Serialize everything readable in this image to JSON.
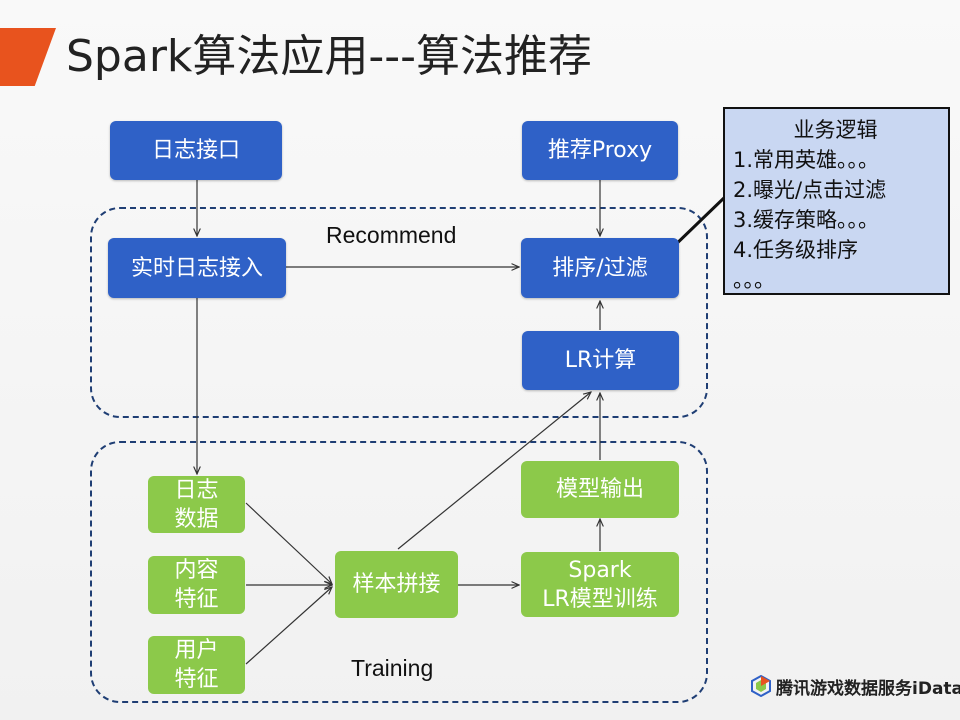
{
  "title": "Spark算法应用---算法推荐",
  "regions": {
    "recommend_label": "Recommend",
    "training_label": "Training"
  },
  "nodes": {
    "log_interface": "日志接口",
    "realtime_ingest": "实时日志接入",
    "recommend_proxy": "推荐Proxy",
    "rank_filter": "排序/过滤",
    "lr_compute": "LR计算",
    "log_data": [
      "日志",
      "数据"
    ],
    "content_features": [
      "内容",
      "特征"
    ],
    "user_features": [
      "用户",
      "特征"
    ],
    "sample_join": "样本拼接",
    "model_output": "模型输出",
    "spark_train": [
      "Spark",
      "LR模型训练"
    ]
  },
  "callout": {
    "title": "业务逻辑",
    "items": [
      "1.常用英雄。。。",
      "2.曝光/点击过滤",
      "3.缓存策略。。。",
      "4.任务级排序",
      "。。。"
    ]
  },
  "logo": {
    "text": "腾讯游戏数据服务iData"
  },
  "colors": {
    "blue_node": "#2f61c7",
    "green_node": "#8cc94a",
    "accent": "#e8531e",
    "callout_bg": "#c9d7f2",
    "region_border": "#1f3e74"
  }
}
